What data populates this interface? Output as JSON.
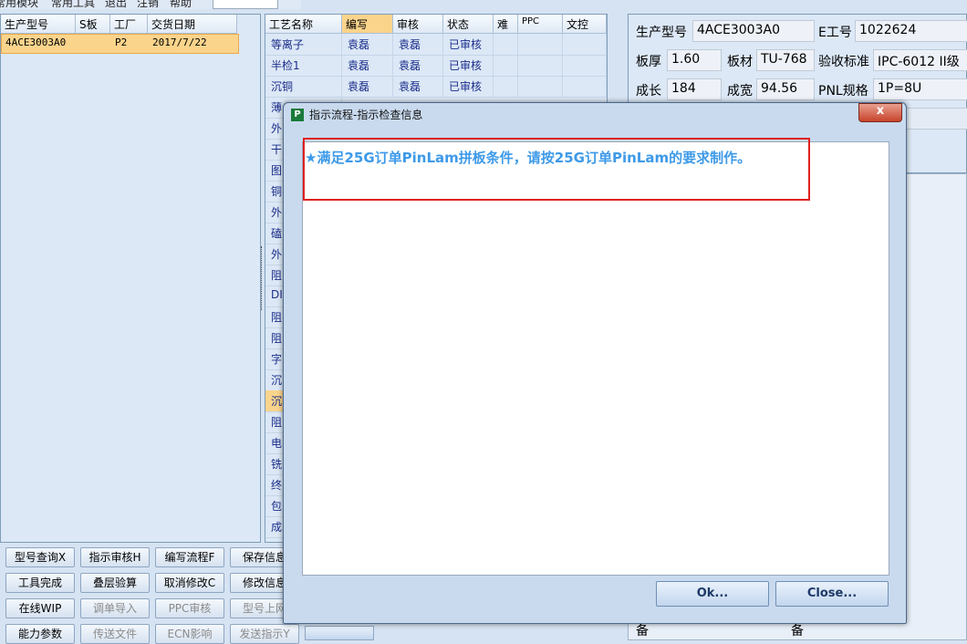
{
  "menubar": {
    "items": [
      "常用模块",
      "常用工具",
      "退出",
      "注销",
      "帮助"
    ]
  },
  "orders": {
    "columns": [
      "生产型号",
      "S板",
      "工厂",
      "交货日期"
    ],
    "rows": [
      {
        "model": "4ACE3003A0",
        "s_board": "",
        "factory": "P2",
        "delivery_date": "2017/7/22"
      }
    ]
  },
  "process": {
    "columns": [
      "工艺名称",
      "编写",
      "审核",
      "状态",
      "难",
      "PPC",
      "文控"
    ],
    "rows": [
      {
        "name": "等离子",
        "writer": "袁磊",
        "reviewer": "袁磊",
        "status": "已审核"
      },
      {
        "name": "半检1",
        "writer": "袁磊",
        "reviewer": "袁磊",
        "status": "已审核"
      },
      {
        "name": "沉铜",
        "writer": "袁磊",
        "reviewer": "袁磊",
        "status": "已审核"
      }
    ],
    "partial_rows": [
      "薄",
      "外",
      "干",
      "图",
      "铜",
      "外",
      "磕",
      "外",
      "阻",
      "DI",
      "阻",
      "阻",
      "字",
      "沉",
      "沉",
      "阻",
      "电",
      "铣",
      "终",
      "包",
      "成"
    ]
  },
  "info": {
    "fields": [
      {
        "label": "生产型号",
        "value": "4ACE3003A0"
      },
      {
        "label": "E工号",
        "value": "1022624"
      },
      {
        "label": "板厚",
        "value": "1.60"
      },
      {
        "label": "板材",
        "value": "TU-768"
      },
      {
        "label": "验收标准",
        "value": "IPC-6012 II级"
      },
      {
        "label": "成长",
        "value": "184"
      },
      {
        "label": "成宽",
        "value": "94.56"
      },
      {
        "label": "PNL规格",
        "value": "1P=8U"
      }
    ]
  },
  "buttons": [
    {
      "label": "型号查询X",
      "enabled": true
    },
    {
      "label": "指示审核H",
      "enabled": true
    },
    {
      "label": "编写流程F",
      "enabled": true
    },
    {
      "label": "保存信息",
      "enabled": true
    },
    {
      "label": "工具完成",
      "enabled": true
    },
    {
      "label": "叠层验算",
      "enabled": true
    },
    {
      "label": "取消修改C",
      "enabled": true
    },
    {
      "label": "修改信息",
      "enabled": true
    },
    {
      "label": "在线WIP",
      "enabled": true
    },
    {
      "label": "调单导入",
      "enabled": false
    },
    {
      "label": "PPC审核",
      "enabled": false
    },
    {
      "label": "型号上网",
      "enabled": false
    },
    {
      "label": "能力参数",
      "enabled": true
    },
    {
      "label": "传送文件",
      "enabled": false
    },
    {
      "label": "ECN影响",
      "enabled": false
    },
    {
      "label": "发送指示Y",
      "enabled": false
    }
  ],
  "footer_labels": [
    "备",
    "备"
  ],
  "dialog": {
    "title": "指示流程-指示检查信息",
    "logo": "P",
    "close_glyph": "x",
    "message": "★满足25G订单PinLam拼板条件，请按25G订单PinLam的要求制作。",
    "ok_label": "Ok...",
    "close_label": "Close..."
  },
  "colors": {
    "selected_row": "#fbd48c",
    "message_text": "#3e9ae8",
    "highlight_border": "#e02020",
    "process_text": "#1a2c8a"
  }
}
